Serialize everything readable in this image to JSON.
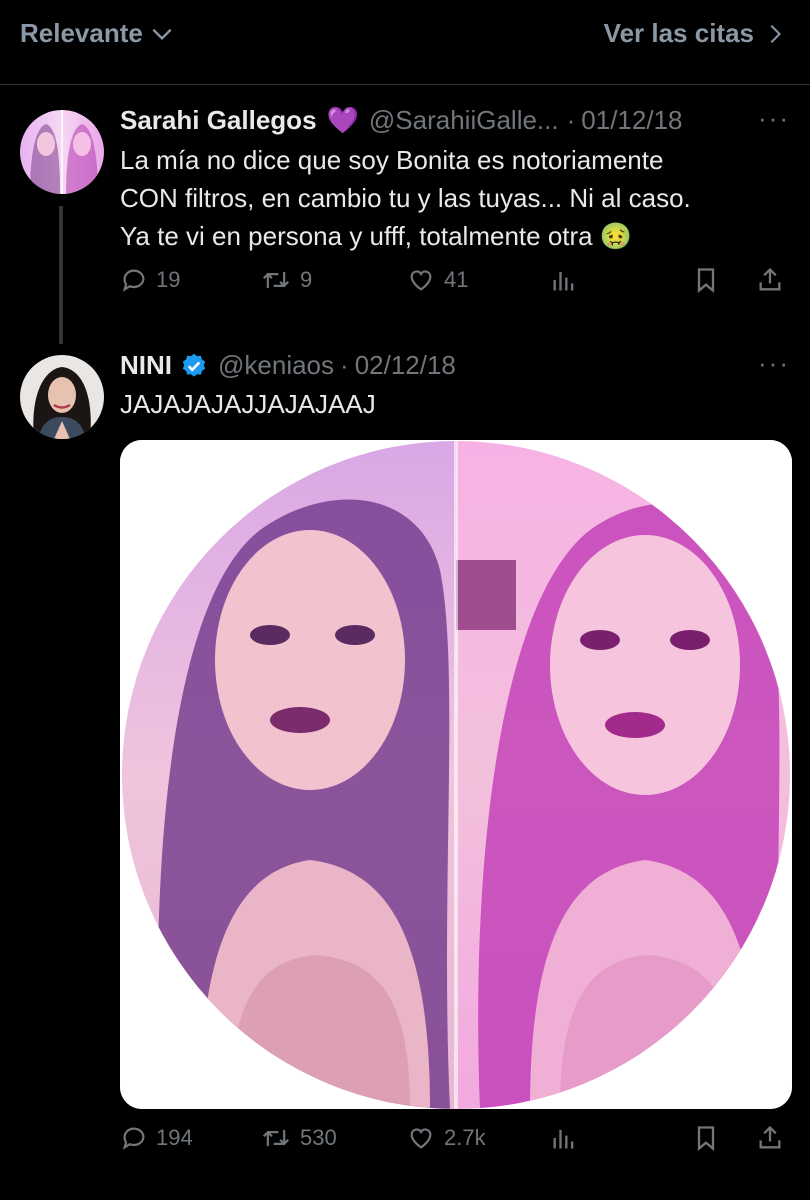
{
  "header": {
    "sort_label": "Relevante",
    "quotes_label": "Ver las citas"
  },
  "tweets": [
    {
      "name": "Sarahi Gallegos",
      "name_emoji": "💜",
      "handle": "@SarahiiGalle...",
      "sep": "·",
      "date": "01/12/18",
      "text_lines": [
        "La mía no dice que soy Bonita es notoriamente",
        "CON filtros, en cambio tu y las tuyas... Ni al caso.",
        "Ya te vi en persona y ufff, totalmente otra"
      ],
      "text_emoji": "🤢",
      "replies": "19",
      "retweets": "9",
      "likes": "41"
    },
    {
      "name": "NINI",
      "verified": true,
      "handle": "@keniaos",
      "sep": "·",
      "date": "02/12/18",
      "text": "JAJAJAJAJJAJAJAAJ",
      "replies": "194",
      "retweets": "530",
      "likes": "2.7k"
    }
  ],
  "colors": {
    "background": "#000000",
    "text": "#e7e9ea",
    "muted": "#71767b",
    "divider": "#2f3336",
    "verified": "#1d9bf0"
  }
}
